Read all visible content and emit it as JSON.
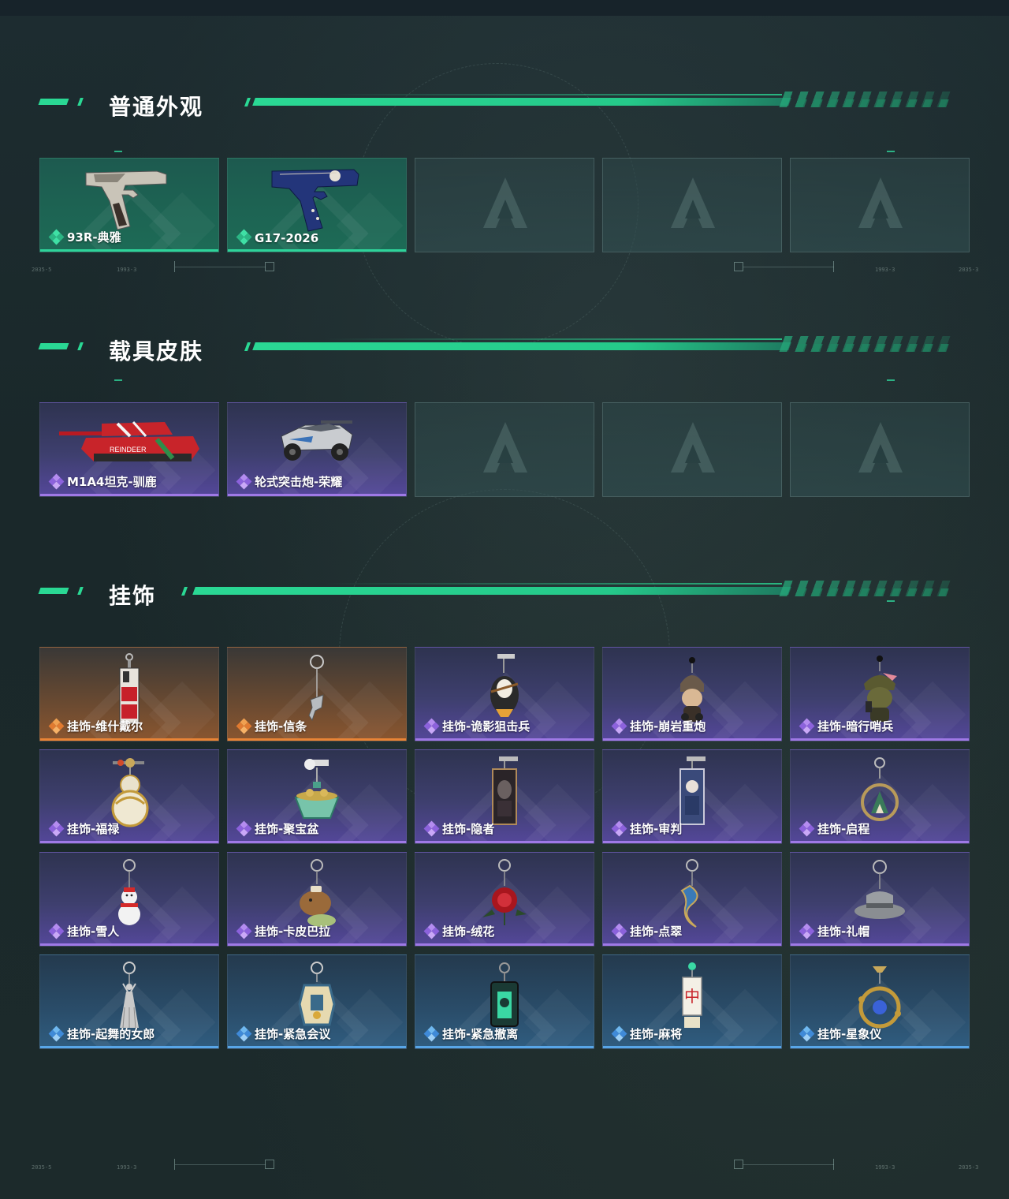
{
  "sections": [
    {
      "title": "普通外观",
      "items": [
        {
          "label": "93R-典雅",
          "rarity": "green",
          "art": "pistol-silver"
        },
        {
          "label": "G17-2026",
          "rarity": "green",
          "art": "pistol-blue"
        },
        {
          "label": "",
          "rarity": "empty"
        },
        {
          "label": "",
          "rarity": "empty"
        },
        {
          "label": "",
          "rarity": "empty"
        }
      ]
    },
    {
      "title": "载具皮肤",
      "items": [
        {
          "label": "M1A4坦克-驯鹿",
          "rarity": "purple",
          "art": "tank-red"
        },
        {
          "label": "轮式突击炮-荣耀",
          "rarity": "purple",
          "art": "armored-car"
        },
        {
          "label": "",
          "rarity": "empty"
        },
        {
          "label": "",
          "rarity": "empty"
        },
        {
          "label": "",
          "rarity": "empty"
        }
      ]
    },
    {
      "title": "挂饰",
      "items": [
        {
          "label": "挂饰-维什戴尔",
          "rarity": "orange",
          "art": "charm-card-red"
        },
        {
          "label": "挂饰-信条",
          "rarity": "orange",
          "art": "charm-ring-silver"
        },
        {
          "label": "挂饰-诡影狙击兵",
          "rarity": "purple",
          "art": "charm-figure-mask"
        },
        {
          "label": "挂饰-崩岩重炮",
          "rarity": "purple",
          "art": "charm-figure-brown"
        },
        {
          "label": "挂饰-暗行哨兵",
          "rarity": "purple",
          "art": "charm-figure-green"
        },
        {
          "label": "挂饰-福禄",
          "rarity": "purple",
          "art": "charm-gourd"
        },
        {
          "label": "挂饰-聚宝盆",
          "rarity": "purple",
          "art": "charm-bowl"
        },
        {
          "label": "挂饰-隐者",
          "rarity": "purple",
          "art": "charm-tarot-dark"
        },
        {
          "label": "挂饰-审判",
          "rarity": "purple",
          "art": "charm-tarot-blue"
        },
        {
          "label": "挂饰-启程",
          "rarity": "purple",
          "art": "charm-ring-gold"
        },
        {
          "label": "挂饰-雪人",
          "rarity": "purple",
          "art": "charm-snowman"
        },
        {
          "label": "挂饰-卡皮巴拉",
          "rarity": "purple",
          "art": "charm-capybara"
        },
        {
          "label": "挂饰-绒花",
          "rarity": "purple",
          "art": "charm-rose"
        },
        {
          "label": "挂饰-点翠",
          "rarity": "purple",
          "art": "charm-phoenix"
        },
        {
          "label": "挂饰-礼帽",
          "rarity": "purple",
          "art": "charm-hat"
        },
        {
          "label": "挂饰-起舞的女郎",
          "rarity": "blue",
          "art": "charm-dancer"
        },
        {
          "label": "挂饰-紧急会议",
          "rarity": "blue",
          "art": "charm-badge"
        },
        {
          "label": "挂饰-紧急撤离",
          "rarity": "blue",
          "art": "charm-green-tag"
        },
        {
          "label": "挂饰-麻将",
          "rarity": "blue",
          "art": "charm-mahjong"
        },
        {
          "label": "挂饰-星象仪",
          "rarity": "blue",
          "art": "charm-orrery"
        }
      ]
    }
  ],
  "mahjong_glyph": "中",
  "colors": {
    "accent": "#2ad894",
    "green": "#2ed39a",
    "purple": "#9f79e6",
    "orange": "#e98436",
    "blue": "#58a6e8"
  },
  "deco_codes": [
    "2035-5",
    "1993-3",
    "1993-3",
    "2035-3"
  ]
}
